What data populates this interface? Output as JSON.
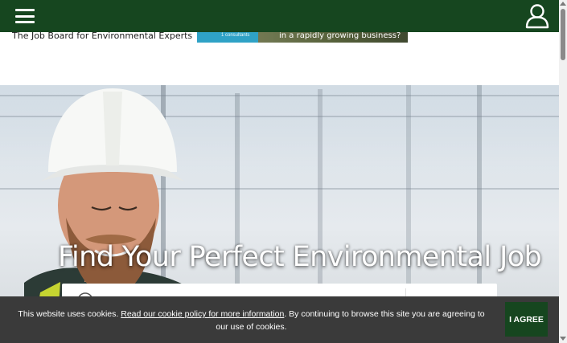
{
  "header": {
    "tagline": "The Job Board for Environmental Experts",
    "menu_icon": "hamburger-menu-icon",
    "user_icon": "user-account-icon",
    "bar_color": "#16461f"
  },
  "ad": {
    "small_text": "1 consultants",
    "headline": "in a rapidly growing business?"
  },
  "hero": {
    "title": "Find Your Perfect Environmental Job",
    "search_icon": "search-icon",
    "search_placeholder": ""
  },
  "cookie": {
    "text_before": "This website uses cookies. ",
    "link_text": "Read our cookie policy for more information",
    "text_after": ". By continuing to browse this site you are agreeing to our use of cookies.",
    "agree_label": "I AGREE",
    "bar_color": "#3a3a3a"
  }
}
